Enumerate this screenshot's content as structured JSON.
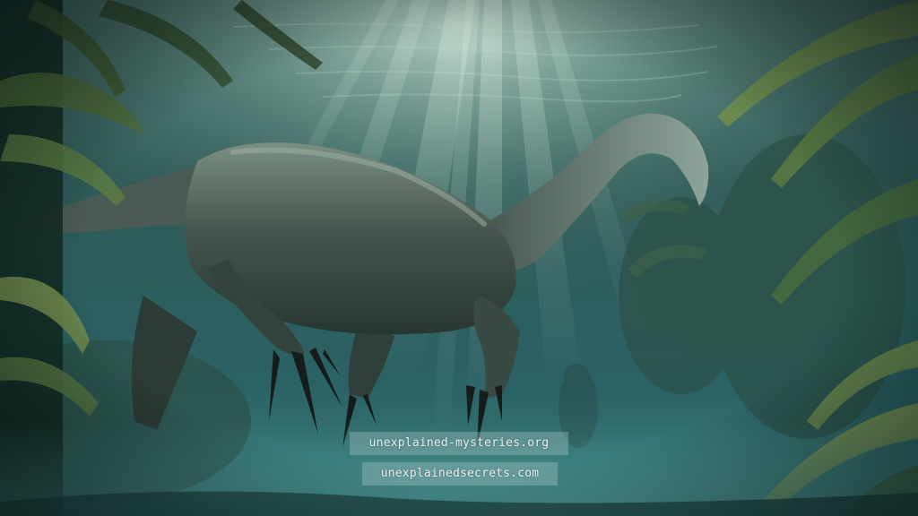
{
  "scene": {
    "subject": "dinosaur-icon",
    "palette": {
      "water_deep": "#0c2a2a",
      "water_mid": "#2f5f5c",
      "water_light": "#a6c7bf",
      "creature": "#3f5048",
      "creature_light": "#6f8479",
      "foliage": "#6f8a4c",
      "foliage_dark": "#1c3528"
    }
  },
  "watermarks": [
    {
      "text": "unexplained-mysteries.org"
    },
    {
      "text": "unexplainedsecrets.com"
    }
  ]
}
